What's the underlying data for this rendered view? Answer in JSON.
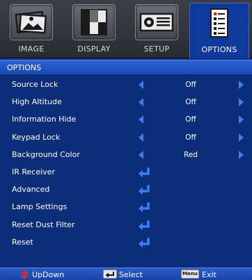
{
  "tabs": [
    {
      "label": "IMAGE",
      "icon": "image-icon"
    },
    {
      "label": "DISPLAY",
      "icon": "display-icon"
    },
    {
      "label": "SETUP",
      "icon": "projector-icon"
    },
    {
      "label": "OPTIONS",
      "icon": "options-icon",
      "active": true
    }
  ],
  "title": "OPTIONS",
  "items": [
    {
      "label": "Source Lock",
      "value": "Off",
      "type": "select"
    },
    {
      "label": "High Altitude",
      "value": "Off",
      "type": "select"
    },
    {
      "label": "Information Hide",
      "value": "Off",
      "type": "select"
    },
    {
      "label": "Keypad Lock",
      "value": "Off",
      "type": "select"
    },
    {
      "label": "Background Color",
      "value": "Red",
      "type": "select"
    },
    {
      "label": "IR Receiver",
      "type": "enter"
    },
    {
      "label": "Advanced",
      "type": "enter"
    },
    {
      "label": "Lamp Settings",
      "type": "enter"
    },
    {
      "label": "Reset Dust Filter",
      "type": "enter"
    },
    {
      "label": "Reset",
      "type": "enter"
    }
  ],
  "footer": {
    "updown_label": "UpDown",
    "select_label": "Select",
    "menu_key": "Menu",
    "exit_label": "Exit"
  },
  "colors": {
    "background": "#0c2e78",
    "title_bar": "#2f62d4",
    "arrow": "#3a7df5",
    "updown_icon": "#e8262a"
  }
}
